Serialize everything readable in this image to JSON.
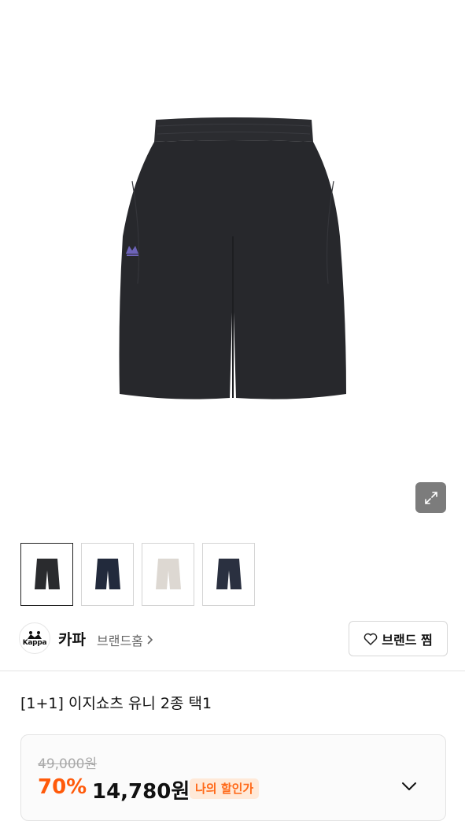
{
  "product": {
    "main_image": "black-shorts-product-image",
    "thumbnails": [
      {
        "name": "black-shorts-thumbnail",
        "color": "#2a2b2e"
      },
      {
        "name": "navy-shorts-thumbnail",
        "color": "#222a3c"
      },
      {
        "name": "beige-shorts-thumbnail",
        "color": "#ddd8d2"
      },
      {
        "name": "darknavy-shorts-thumbnail",
        "color": "#2a3040"
      }
    ],
    "title": "[1+1] 이지쇼츠 유니 2종 택1"
  },
  "zoom": {
    "icon": "expand-icon"
  },
  "brand": {
    "logo_text": "Kappa",
    "name": "카파",
    "home_label": "브랜드홈",
    "like_label": "브랜드 찜"
  },
  "price": {
    "original": "49,000원",
    "discount": "70%",
    "sale": "14,780원",
    "badge": "나의 할인가"
  },
  "colors": {
    "accent_orange": "#ff5a0a",
    "badge_bg": "#ffe9d8"
  }
}
